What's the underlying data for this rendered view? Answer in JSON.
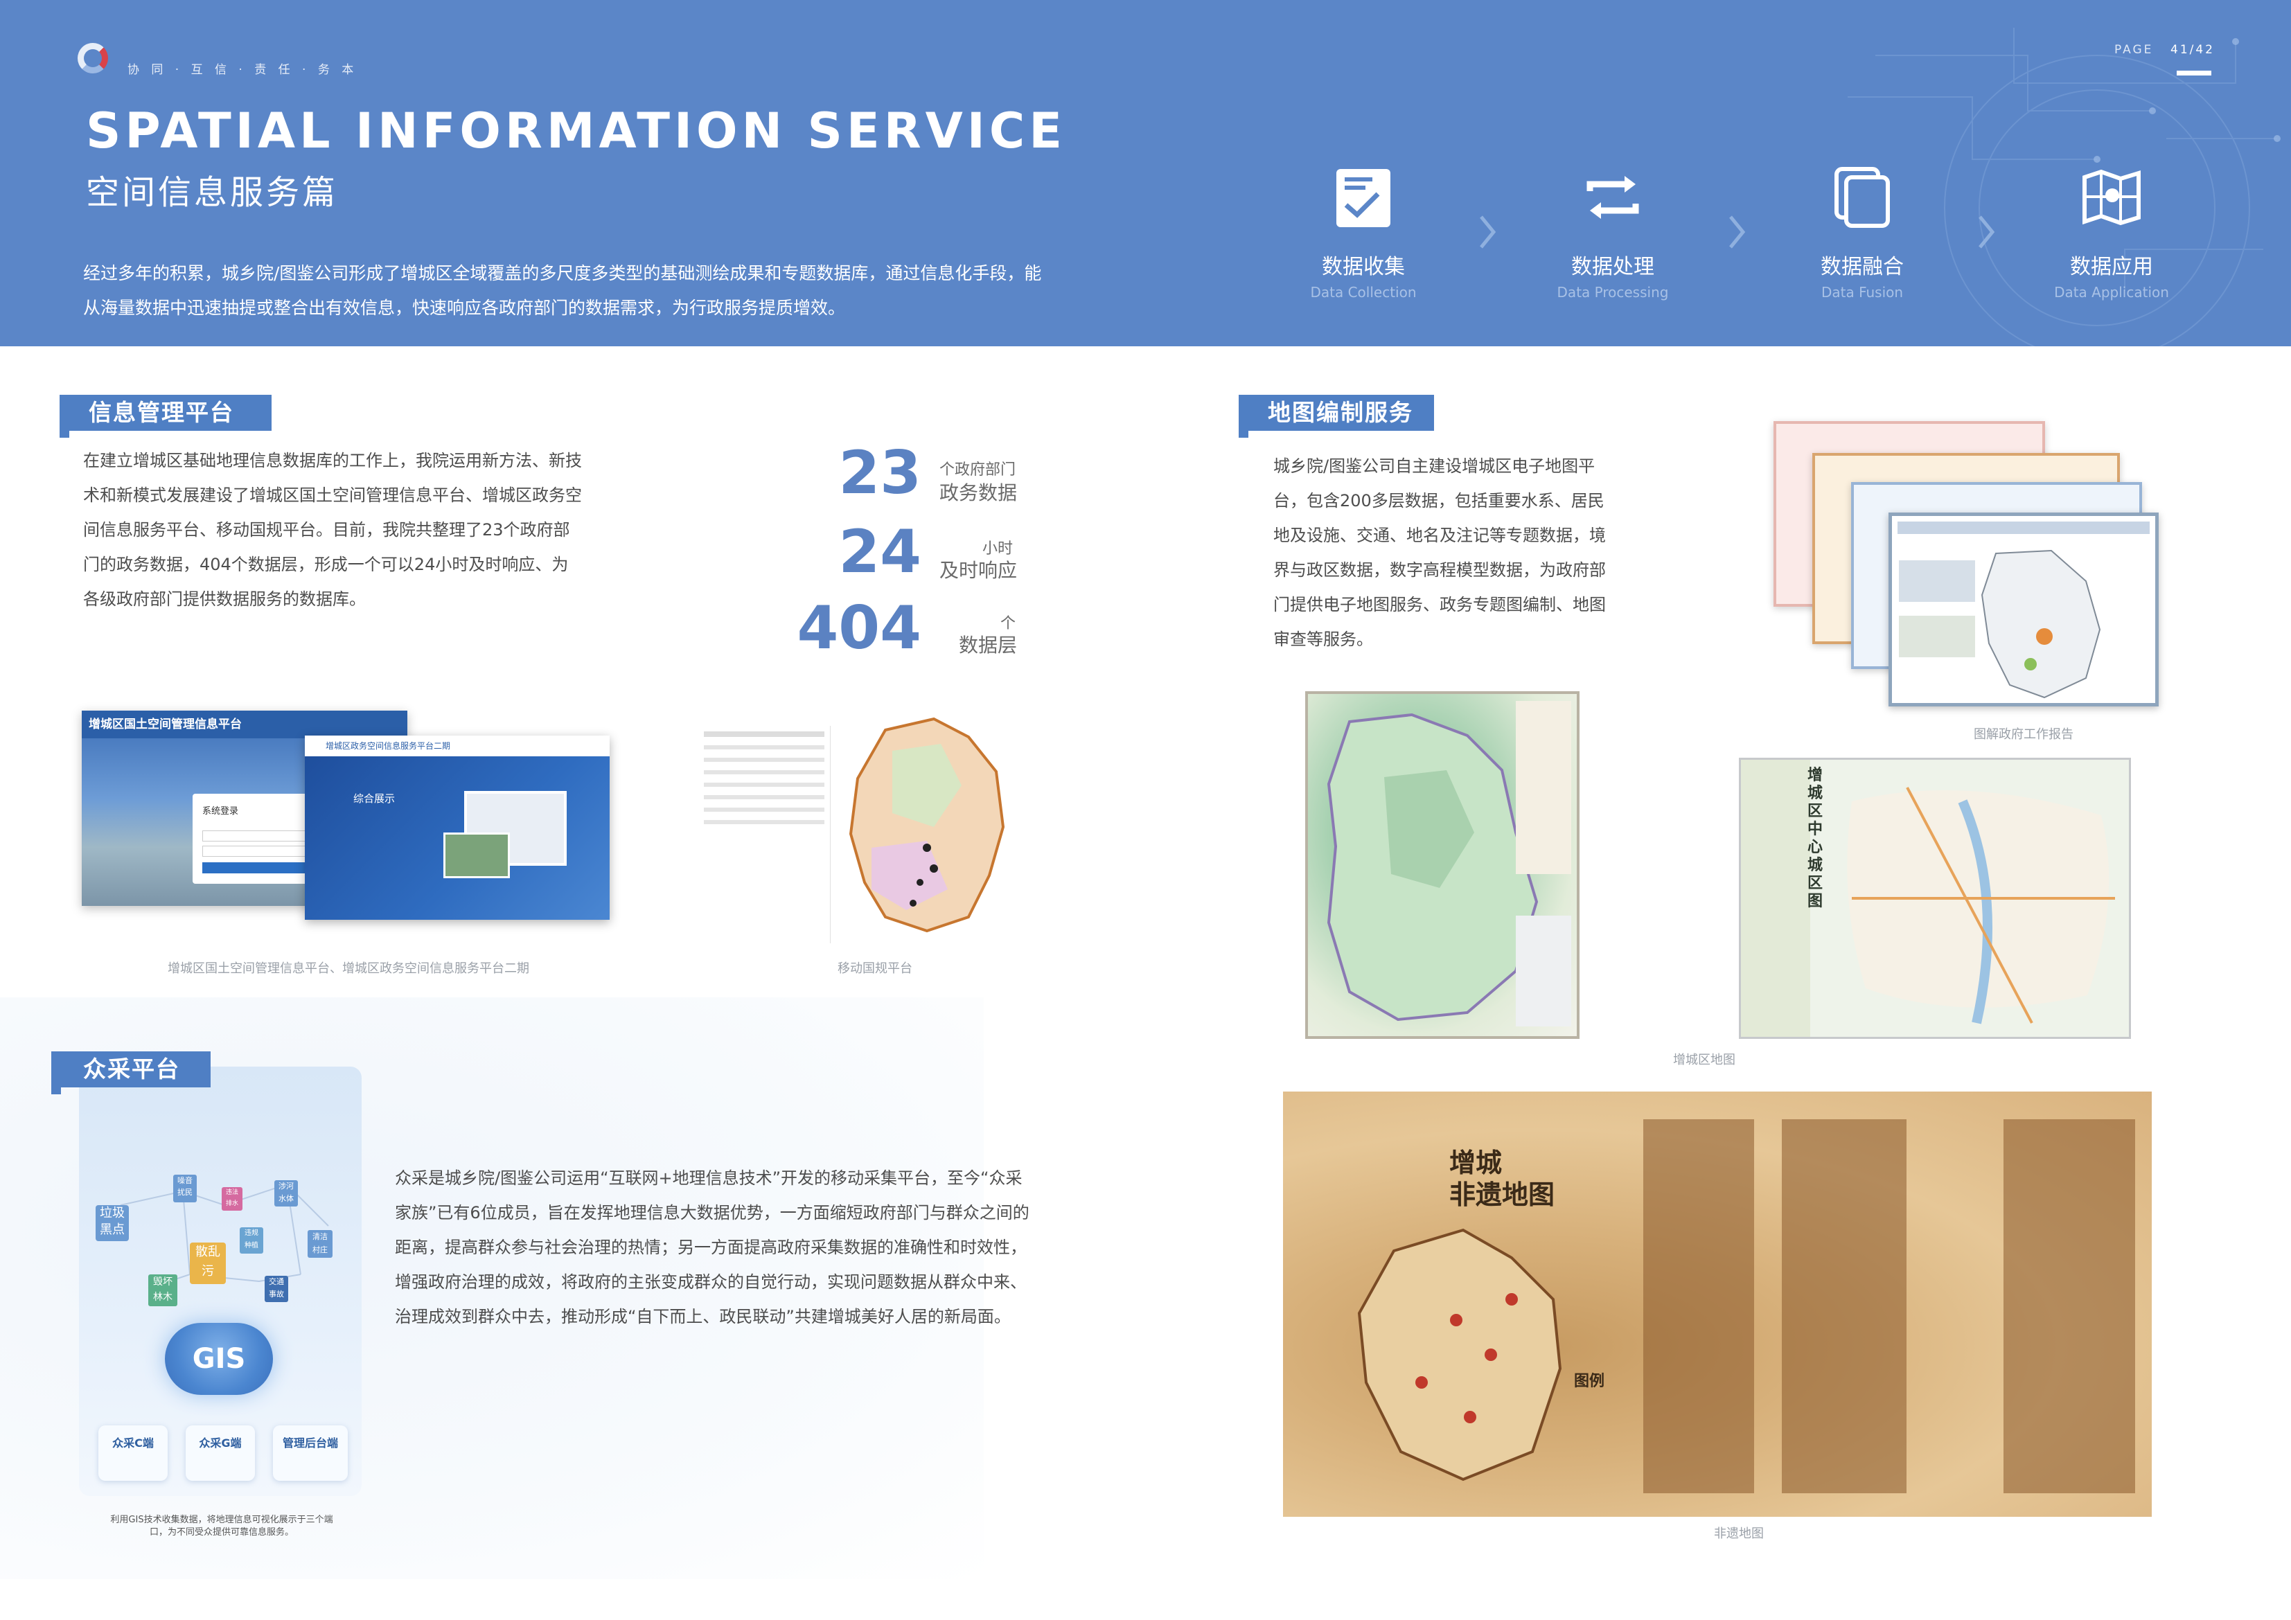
{
  "header": {
    "motto": "协 同 · 互 信 · 责 任 · 务 本",
    "page_label": "PAGE",
    "page_number": "41/42",
    "title_en": "SPATIAL INFORMATION SERVICE",
    "title_cn": "空间信息服务篇",
    "intro": "经过多年的积累，城乡院/图鉴公司形成了增城区全域覆盖的多尺度多类型的基础测绘成果和专题数据库，通过信息化手段，能从海量数据中迅速抽提或整合出有效信息，快速响应各政府部门的数据需求，为行政服务提质增效。",
    "steps": [
      {
        "cn": "数据收集",
        "en": "Data Collection",
        "icon": "checklist-icon"
      },
      {
        "cn": "数据处理",
        "en": "Data Processing",
        "icon": "cycle-arrows-icon"
      },
      {
        "cn": "数据融合",
        "en": "Data Fusion",
        "icon": "layers-icon"
      },
      {
        "cn": "数据应用",
        "en": "Data Application",
        "icon": "map-icon"
      }
    ]
  },
  "info_platform": {
    "label": "信息管理平台",
    "text": "在建立增城区基础地理信息数据库的工作上，我院运用新方法、新技术和新模式发展建设了增城区国土空间管理信息平台、增城区政务空间信息服务平台、移动国规平台。目前，我院共整理了23个政府部门的政务数据，404个数据层，形成一个可以24小时及时响应、为各级政府部门提供数据服务的数据库。",
    "stats": [
      {
        "value": "23",
        "unit": "个政府部门",
        "label": "政务数据"
      },
      {
        "value": "24",
        "unit": "小时",
        "label": "及时响应"
      },
      {
        "value": "404",
        "unit": "个",
        "label": "数据层"
      }
    ],
    "screen1_title": "增城区国土空间管理信息平台",
    "screen1_login": "系统登录",
    "screen2_title": "增城区政务空间信息服务平台二期",
    "screen2_heading": "综合展示",
    "caption_left": "增城区国土空间管理信息平台、增城区政务空间信息服务平台二期",
    "caption_right": "移动国规平台"
  },
  "crowd_platform": {
    "label": "众采平台",
    "text": "众采是城乡院/图鉴公司运用“互联网+地理信息技术”开发的移动采集平台，至今“众采家族”已有6位成员，旨在发挥地理信息大数据优势，一方面缩短政府部门与群众之间的距离，提高群众参与社会治理的热情；另一方面提高政府采集数据的准确性和时效性，增强政府治理的成效，将政府的主张变成群众的自觉行动，实现问题数据从群众中来、治理成效到群众中去，推动形成“自下而上、政民联动”共建增城美好人居的新局面。",
    "cloud_label": "GIS",
    "nodes": [
      "垃圾\n黑点",
      "噪音\n扰民",
      "违法\n排水",
      "涉河\n水体",
      "散乱\n污",
      "违规\n种植",
      "清洁\n村庄",
      "毁坏\n林木",
      "交通\n事故"
    ],
    "terminals": [
      "众采C端",
      "众采G端",
      "管理后台端"
    ],
    "caption": "利用GIS技术收集数据，将地理信息可视化展示于三个端口，为不同受众提供可靠信息服务。"
  },
  "map_service": {
    "label": "地图编制服务",
    "text": "城乡院/图鉴公司自主建设增城区电子地图平台，包含200多层数据，包括重要水系、居民地及设施、交通、地名及注记等专题数据，境界与政区数据，数字高程模型数据，为政府部门提供电子地图服务、政务专题图编制、地图审查等服务。",
    "caption_reports": "图解政府工作报告",
    "caption_district": "增城区地图",
    "center_map_title": "增城区中心城区图",
    "heritage_title": "增城\n非遗地图",
    "heritage_legend": "图例",
    "caption_heritage": "非遗地图"
  },
  "colors": {
    "header_bg": "#5b86c8",
    "accent_blue": "#4f7fc4",
    "stat_blue": "#5b82c2",
    "old_map": "#d9b27e"
  }
}
